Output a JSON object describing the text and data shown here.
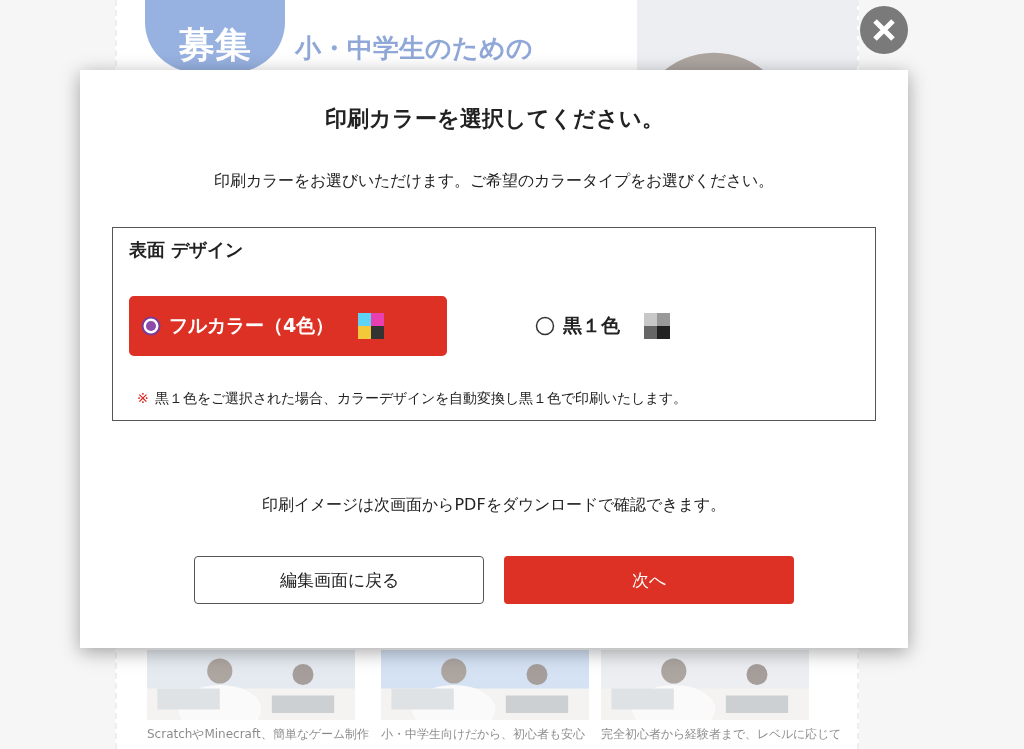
{
  "background_page": {
    "badge": "募集",
    "headline": "小・中学生のための",
    "cards": [
      {
        "caption": "ScratchやMinecraft、簡単なゲーム制作"
      },
      {
        "caption": "小・中学生向けだから、初心者も安心"
      },
      {
        "caption": "完全初心者から経験者まで、レベルに応じて"
      }
    ]
  },
  "modal": {
    "title": "印刷カラーを選択してください。",
    "description": "印刷カラーをお選びいただけます。ご希望のカラータイプをお選びください。",
    "section": {
      "title": "表面 デザイン",
      "options": [
        {
          "label": "フルカラー（4色）",
          "kind": "color",
          "selected": true
        },
        {
          "label": "黒１色",
          "kind": "mono",
          "selected": false
        }
      ],
      "note_mark": "※",
      "note": "黒１色をご選択された場合、カラーデザインを自動変換し黒１色で印刷いたします。"
    },
    "info": "印刷イメージは次画面からPDFをダウンロードで確認できます。",
    "buttons": [
      {
        "label": "編集画面に戻る",
        "kind": "secondary"
      },
      {
        "label": "次へ",
        "kind": "primary"
      }
    ]
  }
}
